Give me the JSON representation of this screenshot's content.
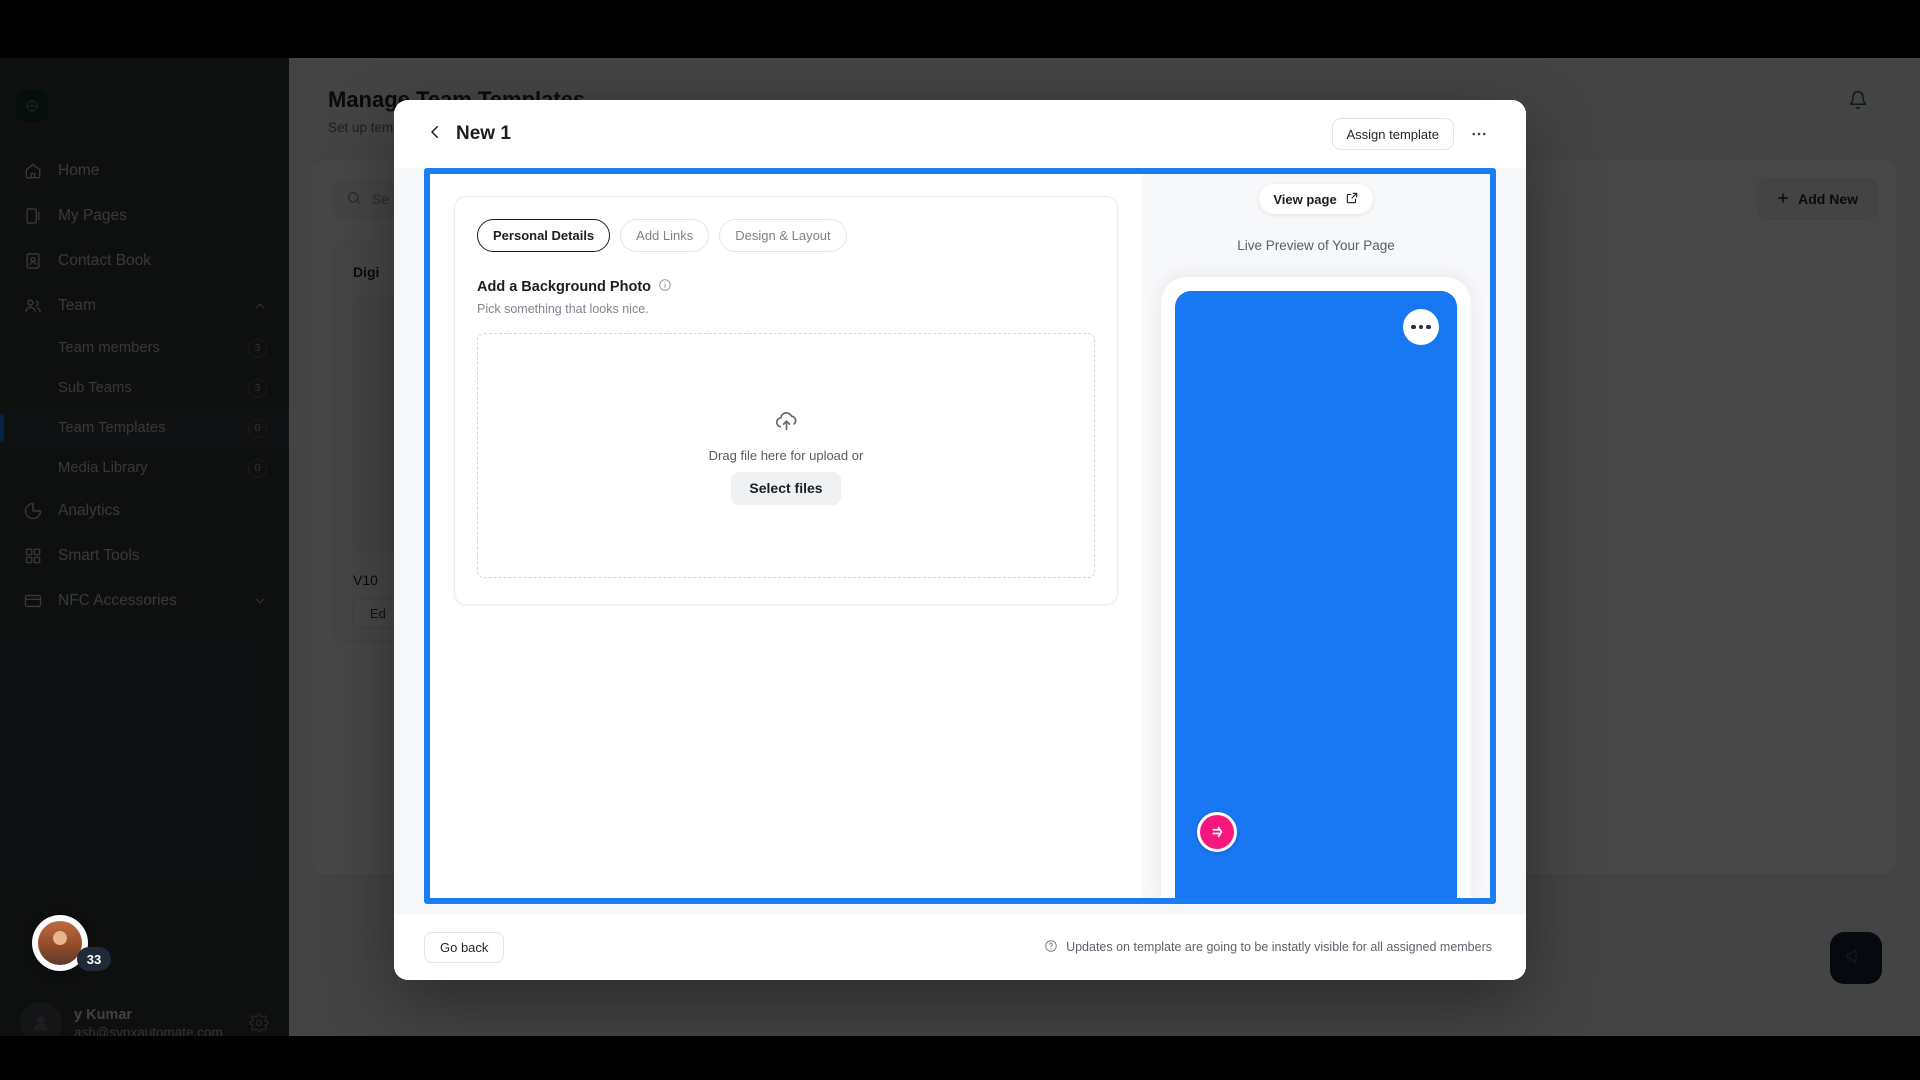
{
  "sidebar": {
    "brand_logo_icon": "app-logo-icon",
    "items": [
      {
        "label": "Home",
        "icon": "home-icon",
        "type": "link"
      },
      {
        "label": "My Pages",
        "icon": "pages-icon",
        "type": "link"
      },
      {
        "label": "Contact Book",
        "icon": "contact-book-icon",
        "type": "link"
      },
      {
        "label": "Team",
        "icon": "team-icon",
        "type": "group",
        "expanded": true,
        "chevron": "chevron-up-icon"
      },
      {
        "label": "Analytics",
        "icon": "analytics-icon",
        "type": "link"
      },
      {
        "label": "Smart Tools",
        "icon": "smart-tools-icon",
        "type": "link"
      },
      {
        "label": "NFC Accessories",
        "icon": "nfc-card-icon",
        "type": "group",
        "expanded": false,
        "chevron": "chevron-down-icon"
      }
    ],
    "team_subitems": [
      {
        "label": "Team members",
        "count": "3",
        "active": false
      },
      {
        "label": "Sub Teams",
        "count": "3",
        "active": false
      },
      {
        "label": "Team Templates",
        "count": "0",
        "active": true
      },
      {
        "label": "Media Library",
        "count": "0",
        "active": false
      }
    ],
    "user": {
      "name": "y Kumar",
      "email": "ash@synxautomate.com",
      "settings_icon": "gear-icon",
      "avatar_badge": "33"
    }
  },
  "background_page": {
    "title": "Manage Team Templates",
    "subtitle": "Set up temp",
    "notification_icon": "bell-icon",
    "search_placeholder": "Se",
    "search_icon": "search-icon",
    "add_new_label": "Add New",
    "add_new_icon": "plus-icon",
    "card_label": "Digi",
    "card_name": "V10",
    "card_edit_label": "Ed",
    "chat_icon": "megaphone-icon"
  },
  "modal": {
    "back_icon": "chevron-left-icon",
    "title": "New 1",
    "assign_template_label": "Assign template",
    "more_icon": "ellipsis-icon",
    "highlight_color": "#1a7df5",
    "tabs": [
      {
        "label": "Personal Details",
        "active": true
      },
      {
        "label": "Add Links",
        "active": false
      },
      {
        "label": "Design & Layout",
        "active": false
      }
    ],
    "section": {
      "title": "Add a Background Photo",
      "info_icon": "info-icon",
      "hint": "Pick something that looks nice.",
      "dropzone": {
        "upload_icon": "cloud-upload-icon",
        "text": "Drag file here for upload or",
        "button_label": "Select files"
      }
    },
    "preview": {
      "view_page_label": "View page",
      "view_page_icon": "external-link-icon",
      "live_preview_label": "Live Preview of Your Page",
      "phone_menu_icon": "ellipsis-icon",
      "phone_background_color": "#1877f2",
      "phone_logo_icon": "brand-circle-icon",
      "phone_logo_color": "#f5167e"
    },
    "footer": {
      "go_back_label": "Go back",
      "note_icon": "help-circle-icon",
      "note": "Updates on template are going to be instatly visible for all assigned members"
    }
  }
}
